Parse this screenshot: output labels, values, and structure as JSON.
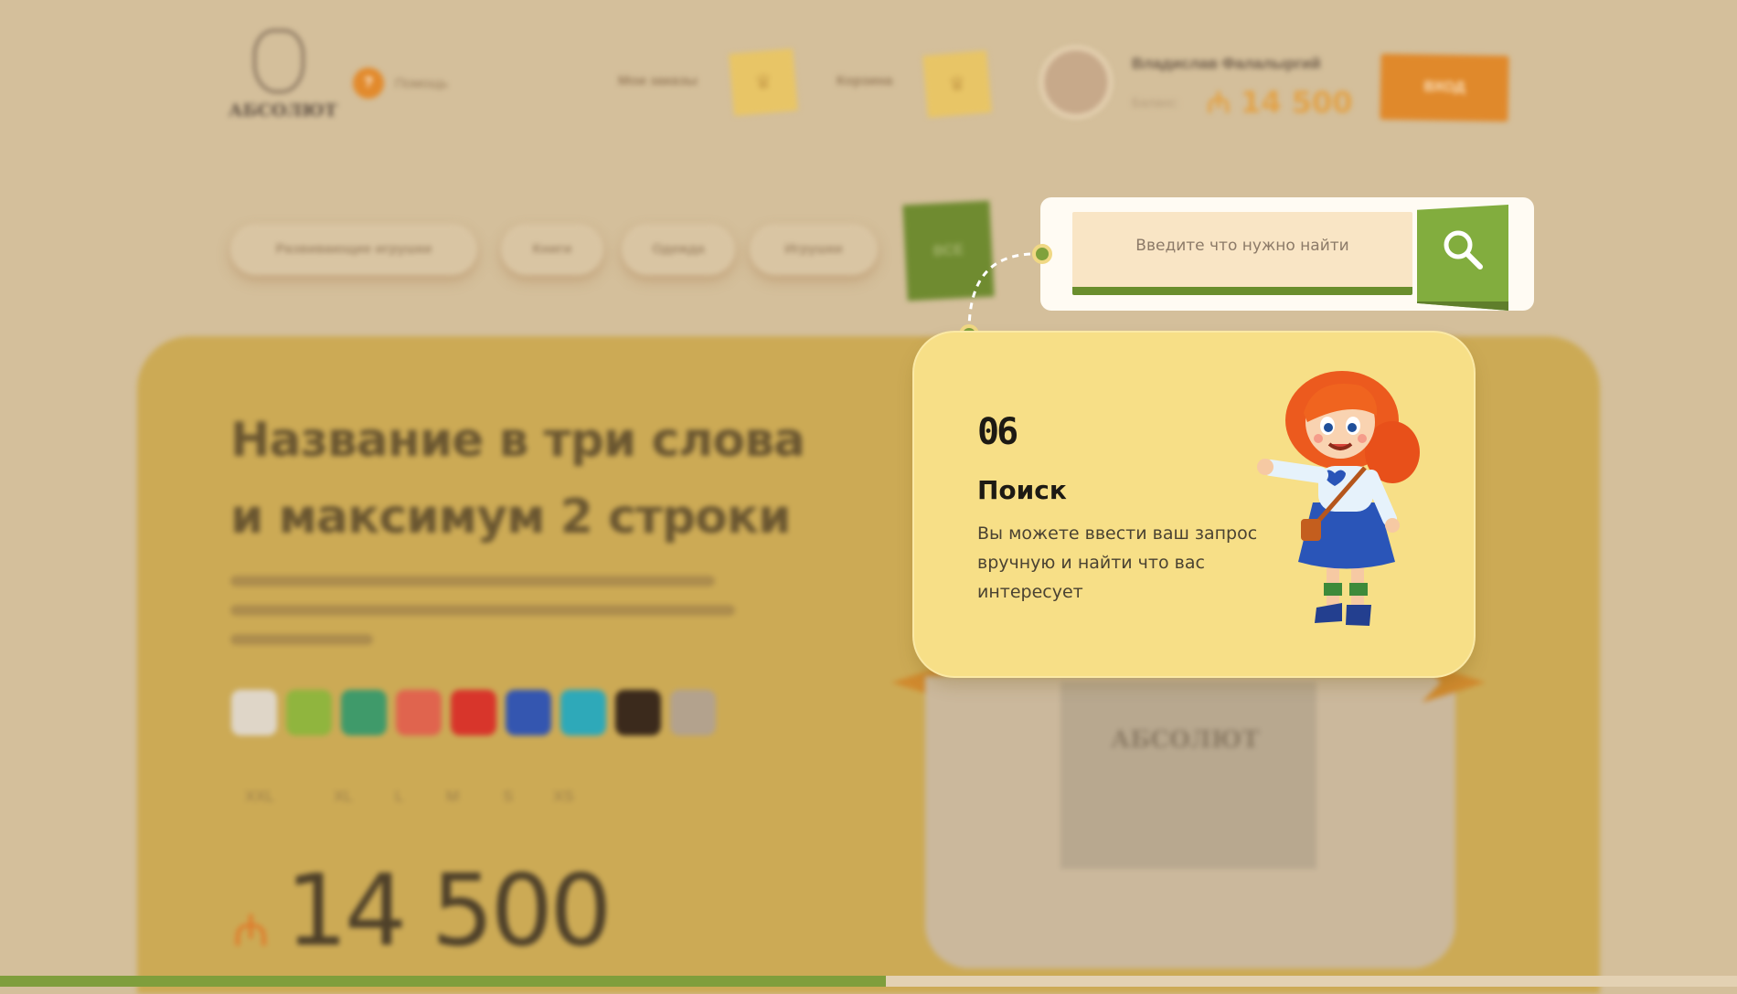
{
  "header": {
    "logo_text": "АБСОЛЮТ",
    "help_label": "Помощь",
    "orders_label": "Мои заказы",
    "cart_label": "Корзина",
    "user_name": "Владислав Фалалыргий",
    "balance_label": "Баланс:",
    "balance_value": "₼ 14 500",
    "login_label": "ВХОД"
  },
  "categories": [
    {
      "label": "Развивающие игрушки"
    },
    {
      "label": "Книги"
    },
    {
      "label": "Одежда"
    },
    {
      "label": "Игрушки"
    }
  ],
  "categories_all_label": "ВСЕ",
  "product": {
    "title_line1": "Название в три слова",
    "title_line2": "и максимум 2 строки",
    "color_swatches": [
      "#dfd6c8",
      "#90b53e",
      "#3f9a6a",
      "#e0644e",
      "#d8352b",
      "#3456b0",
      "#2ea9b9",
      "#3b2a1c",
      "#b3a28d"
    ],
    "sizes": [
      "XXL",
      "XL",
      "L",
      "M",
      "S",
      "XS"
    ],
    "currency_icon": "abzal-currency-icon",
    "price": "14 500",
    "image_brand": "АБСОЛЮТ"
  },
  "search": {
    "placeholder": "Введите что нужно найти",
    "button_icon": "search-icon"
  },
  "tutorial": {
    "step": "06",
    "title": "Поиск",
    "text": "Вы можете ввести ваш запрос вручную и найти что вас интересует"
  },
  "progress": {
    "fraction": 0.51
  },
  "colors": {
    "accent_green": "#82ad3e",
    "accent_orange": "#e0892b",
    "tooltip_bg": "#f7df87",
    "page_bg": "#d4bf9b"
  }
}
